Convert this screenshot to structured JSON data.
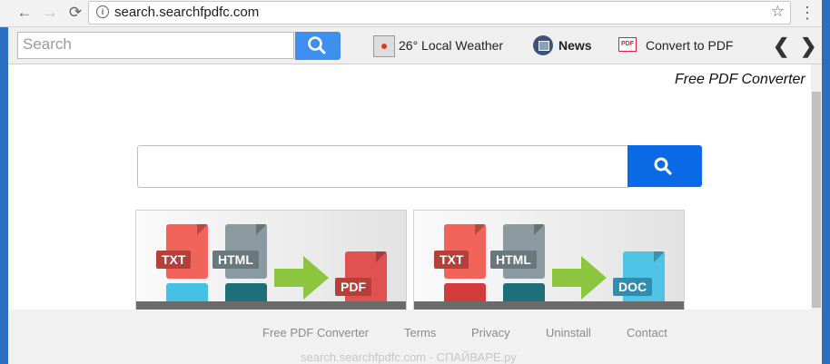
{
  "browser": {
    "url": "search.searchfpdfc.com",
    "back_icon": "←",
    "forward_icon": "→",
    "reload_icon": "⟳",
    "star_icon": "☆",
    "menu_icon": "⋮"
  },
  "toolbar": {
    "search_placeholder": "Search",
    "weather_label": "26° Local Weather",
    "news_label": "News",
    "convert_label": "Convert to PDF",
    "prev": "❮",
    "next": "❯"
  },
  "page": {
    "title": "Free PDF Converter",
    "search_value": ""
  },
  "cards": [
    {
      "from1": "TXT",
      "from2": "HTML",
      "to": "PDF",
      "to_color": "#e05252"
    },
    {
      "from1": "TXT",
      "from2": "HTML",
      "to": "DOC",
      "to_color": "#4fc3e6"
    }
  ],
  "footer": {
    "links": [
      "Free PDF Converter",
      "Terms",
      "Privacy",
      "Uninstall",
      "Contact"
    ],
    "watermark": "search.searchfpdfc.com - СПАЙВАРЕ.ру"
  },
  "colors": {
    "accent": "#0a6ae6",
    "toolbar_button": "#3d8ff0",
    "desktop": "#2b6fc0"
  }
}
